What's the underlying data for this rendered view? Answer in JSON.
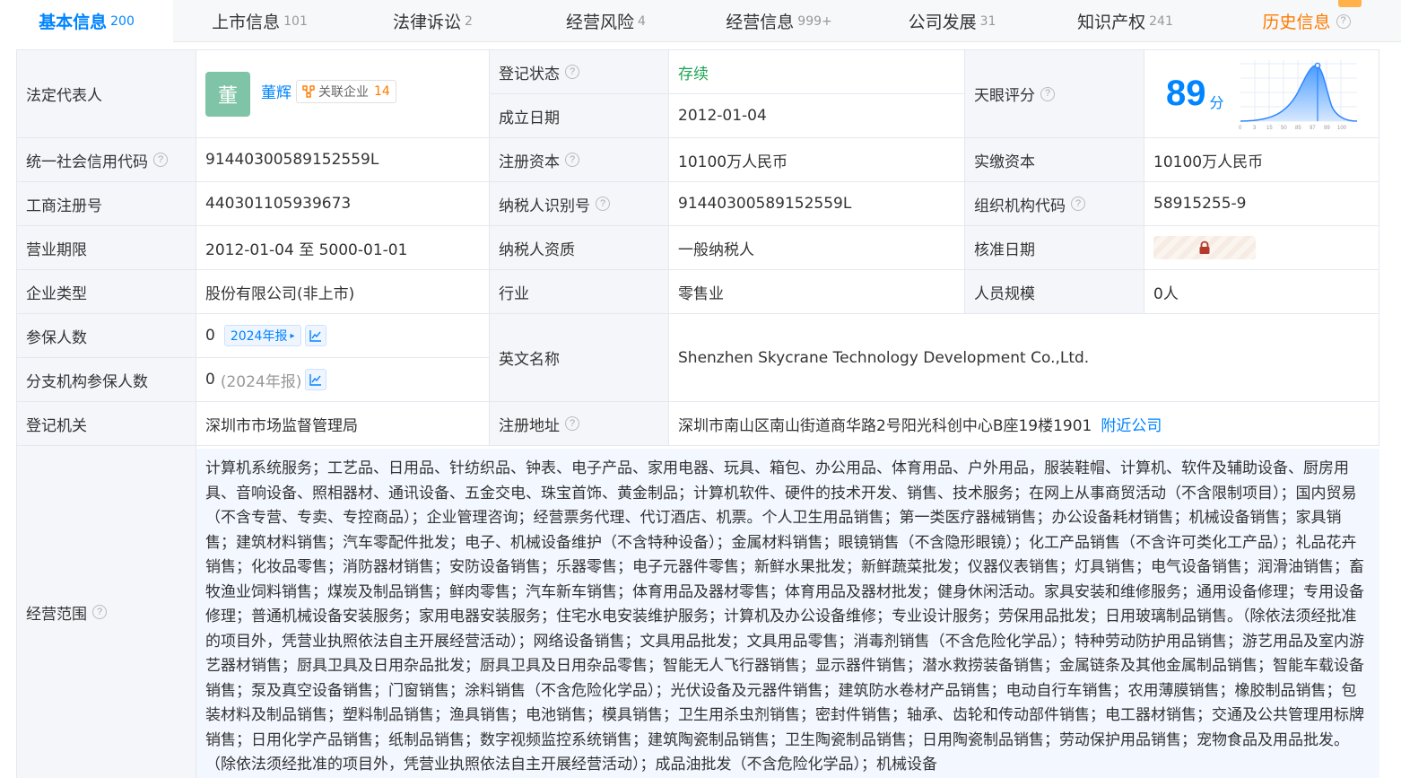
{
  "tabs": [
    {
      "label": "基本信息",
      "count": "200",
      "active": true
    },
    {
      "label": "上市信息",
      "count": "101"
    },
    {
      "label": "法律诉讼",
      "count": "2"
    },
    {
      "label": "经营风险",
      "count": "4"
    },
    {
      "label": "经营信息",
      "count": "999+"
    },
    {
      "label": "公司发展",
      "count": "31"
    },
    {
      "label": "知识产权",
      "count": "241"
    },
    {
      "label": "历史信息"
    }
  ],
  "info": {
    "legal_rep_label": "法定代表人",
    "legal_rep_avatar": "董",
    "legal_rep_name": "董辉",
    "assoc_label": "关联企业",
    "assoc_count": "14",
    "reg_status_label": "登记状态",
    "reg_status": "存续",
    "founded_label": "成立日期",
    "founded": "2012-01-04",
    "score_label": "天眼评分",
    "score": "89",
    "score_unit": "分",
    "score_ticks": [
      "0",
      "3",
      "15",
      "50",
      "85",
      "97",
      "99",
      "100"
    ],
    "credit_code_label": "统一社会信用代码",
    "credit_code": "91440300589152559L",
    "reg_capital_label": "注册资本",
    "reg_capital": "10100万人民币",
    "paid_capital_label": "实缴资本",
    "paid_capital": "10100万人民币",
    "biz_reg_no_label": "工商注册号",
    "biz_reg_no": "440301105939673",
    "taxpayer_id_label": "纳税人识别号",
    "taxpayer_id": "91440300589152559L",
    "org_code_label": "组织机构代码",
    "org_code": "58915255-9",
    "term_label": "营业期限",
    "term": "2012-01-04 至 5000-01-01",
    "taxpayer_qual_label": "纳税人资质",
    "taxpayer_qual": "一般纳税人",
    "approval_date_label": "核准日期",
    "type_label": "企业类型",
    "type": "股份有限公司(非上市)",
    "industry_label": "行业",
    "industry": "零售业",
    "staff_label": "人员规模",
    "staff": "0人",
    "insured_label": "参保人数",
    "insured": "0",
    "insured_report": "2024年报",
    "branch_insured_label": "分支机构参保人数",
    "branch_insured": "0",
    "branch_insured_report": "(2024年报)",
    "english_name_label": "英文名称",
    "english_name": "Shenzhen Skycrane Technology Development Co.,Ltd.",
    "reg_authority_label": "登记机关",
    "reg_authority": "深圳市市场监督管理局",
    "reg_address_label": "注册地址",
    "reg_address": "深圳市南山区南山街道商华路2号阳光科创中心B座19楼1901",
    "nearby_label": "附近公司",
    "scope_label": "经营范围",
    "scope": "计算机系统服务；工艺品、日用品、针纺织品、钟表、电子产品、家用电器、玩具、箱包、办公用品、体育用品、户外用品，服装鞋帽、计算机、软件及辅助设备、厨房用具、音响设备、照相器材、通讯设备、五金交电、珠宝首饰、黄金制品；计算机软件、硬件的技术开发、销售、技术服务；在网上从事商贸活动（不含限制项目）；国内贸易（不含专营、专卖、专控商品）；企业管理咨询；经营票务代理、代订酒店、机票。个人卫生用品销售；第一类医疗器械销售；办公设备耗材销售；机械设备销售；家具销售；建筑材料销售；汽车零配件批发；电子、机械设备维护（不含特种设备）；金属材料销售；眼镜销售（不含隐形眼镜）；化工产品销售（不含许可类化工产品）；礼品花卉销售；化妆品零售；消防器材销售；安防设备销售；乐器零售；电子元器件零售；新鲜水果批发；新鲜蔬菜批发；仪器仪表销售；灯具销售；电气设备销售；润滑油销售；畜牧渔业饲料销售；煤炭及制品销售；鲜肉零售；汽车新车销售；体育用品及器材零售；体育用品及器材批发；健身休闲活动。家具安装和维修服务；通用设备修理；专用设备修理；普通机械设备安装服务；家用电器安装服务；住宅水电安装维护服务；计算机及办公设备维修；专业设计服务；劳保用品批发；日用玻璃制品销售。（除依法须经批准的项目外，凭营业执照依法自主开展经营活动）；网络设备销售；文具用品批发；文具用品零售；消毒剂销售（不含危险化学品）；特种劳动防护用品销售；游艺用品及室内游艺器材销售；厨具卫具及日用杂品批发；厨具卫具及日用杂品零售；智能无人飞行器销售；显示器件销售；潜水救捞装备销售；金属链条及其他金属制品销售；智能车载设备销售；泵及真空设备销售；门窗销售；涂料销售（不含危险化学品）；光伏设备及元器件销售；建筑防水卷材产品销售；电动自行车销售；农用薄膜销售；橡胶制品销售；包装材料及制品销售；塑料制品销售；渔具销售；电池销售；模具销售；卫生用杀虫剂销售；密封件销售；轴承、齿轮和传动部件销售；电工器材销售；交通及公共管理用标牌销售；日用化学产品销售；纸制品销售；数字视频监控系统销售；建筑陶瓷制品销售；卫生陶瓷制品销售；日用陶瓷制品销售；劳动保护用品销售；宠物食品及用品批发。（除依法须经批准的项目外，凭营业执照依法自主开展经营活动）；成品油批发（不含危险化学品）；机械设备"
  },
  "colors": {
    "accent": "#0084ff",
    "green": "#22a555",
    "orange": "#ff7a00",
    "label_bg": "#f4f6fa"
  }
}
